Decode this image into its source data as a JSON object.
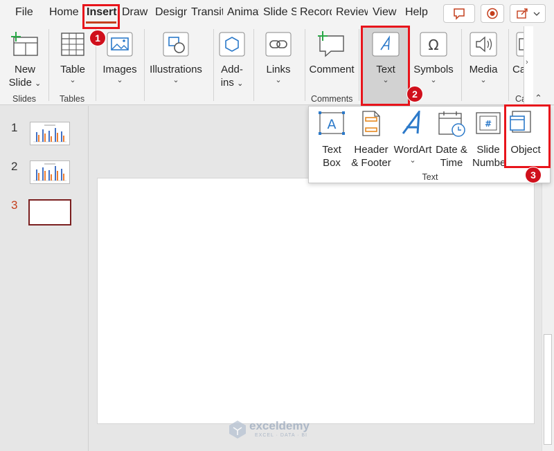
{
  "tabs": [
    "File",
    "Home",
    "Insert",
    "Draw",
    "Design",
    "Transitions",
    "Animations",
    "Slide Show",
    "Record",
    "Review",
    "View",
    "Help"
  ],
  "ribbon": {
    "new_slide": [
      "New",
      "Slide"
    ],
    "table": "Table",
    "images": "Images",
    "illustrations": "Illustrations",
    "addins": [
      "Add-",
      "ins"
    ],
    "links": "Links",
    "comment": "Comment",
    "text": "Text",
    "symbols": "Symbols",
    "media": "Media",
    "camera_partial": "Ca",
    "groups": {
      "slides": "Slides",
      "tables": "Tables",
      "comments": "Comments",
      "camera_partial": "Ca"
    }
  },
  "dropdown": {
    "text_box": [
      "Text",
      "Box"
    ],
    "header_footer": [
      "Header",
      "& Footer"
    ],
    "wordart": "WordArt",
    "date_time": [
      "Date &",
      "Time"
    ],
    "slide_number": [
      "Slide",
      "Number"
    ],
    "object": "Object",
    "group_label": "Text"
  },
  "slides": [
    "1",
    "2",
    "3"
  ],
  "badges": [
    "1",
    "2",
    "3"
  ],
  "watermark": {
    "title": "exceldemy",
    "subtitle": "EXCEL · DATA · BI"
  },
  "colors": {
    "accent": "#c43e1c",
    "highlight": "#e8141b",
    "badge": "#d0101c",
    "icon_blue": "#2b79c9",
    "icon_orange": "#e6891f"
  }
}
